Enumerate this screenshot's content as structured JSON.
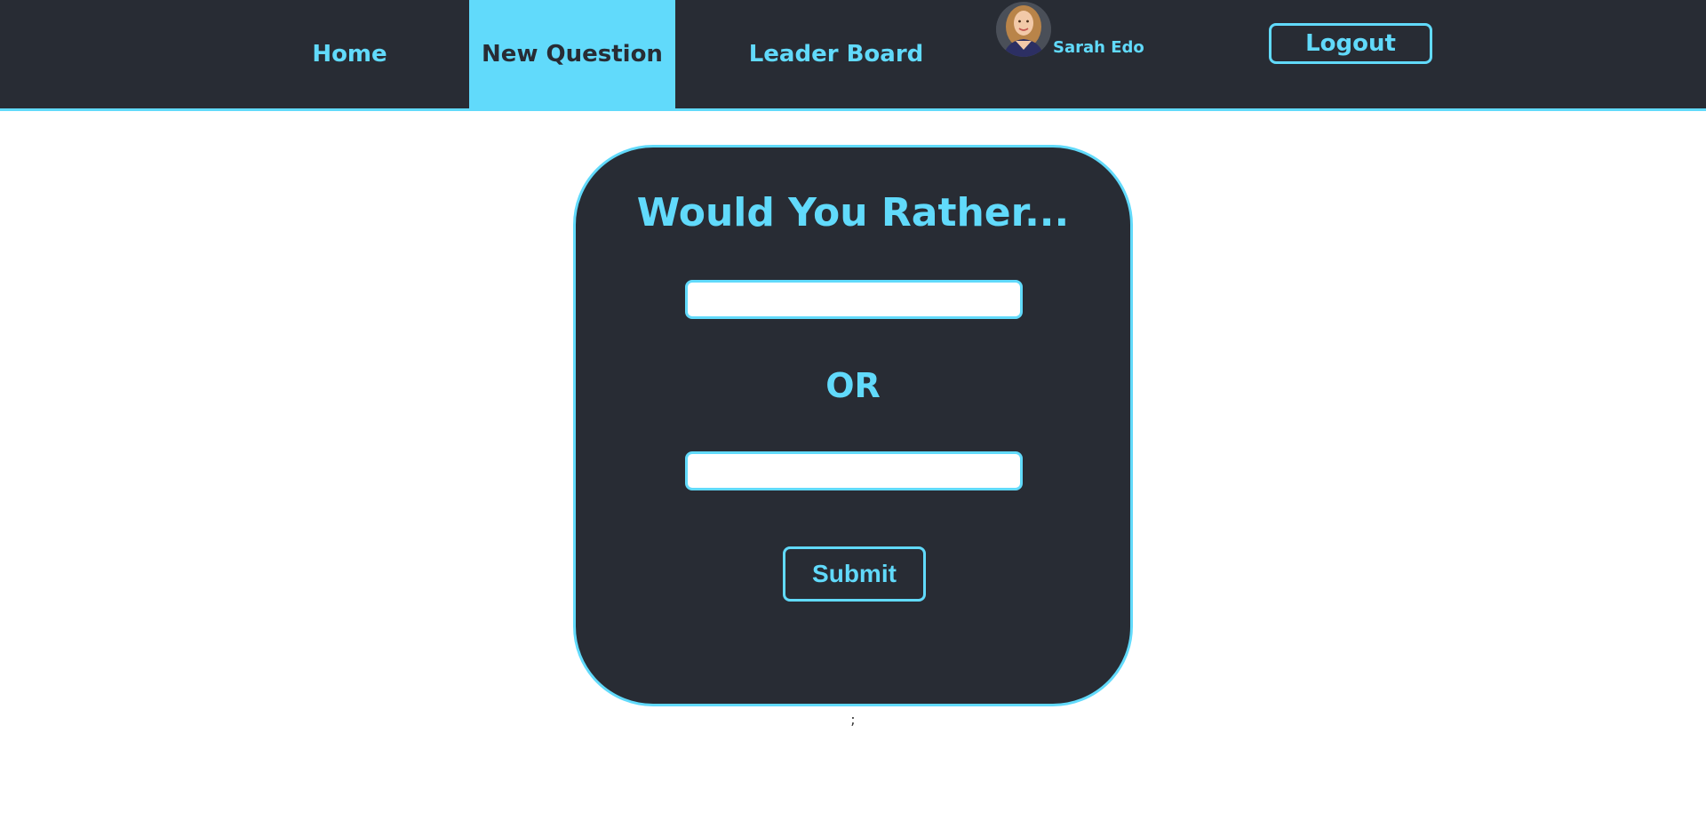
{
  "nav": {
    "home_label": "Home",
    "new_question_label": "New Question",
    "leader_board_label": "Leader Board",
    "active_tab": "New Question",
    "user_name": "Sarah Edo",
    "logout_label": "Logout"
  },
  "form": {
    "title": "Would You Rather...",
    "option_one_value": "",
    "or_label": "OR",
    "option_two_value": "",
    "submit_label": "Submit"
  },
  "footer": {
    "stray_text": ";"
  },
  "colors": {
    "accent": "#61dafb",
    "dark": "#282c34",
    "background": "#ffffff"
  }
}
